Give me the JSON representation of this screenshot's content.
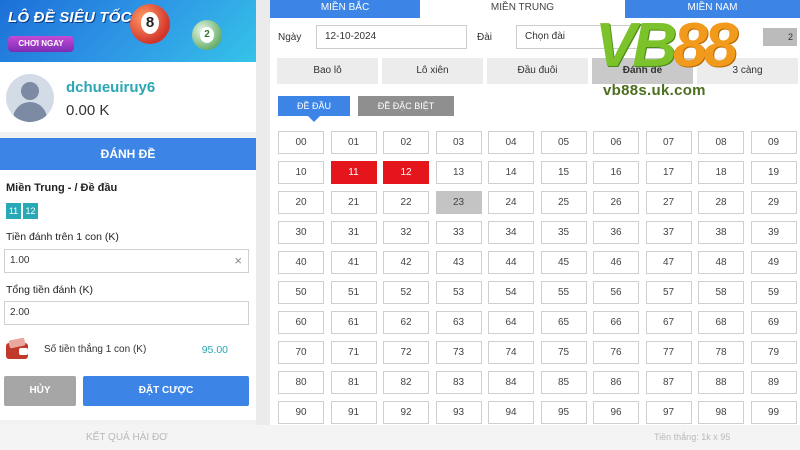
{
  "banner": {
    "title": "LÔ ĐỀ SIÊU TỐC",
    "button": "CHƠI NGAY",
    "ball_big": "8",
    "ball_small": "2"
  },
  "user": {
    "name": "dchueuiruy6",
    "balance": "0.00 K"
  },
  "bet_panel": {
    "header": "ĐÁNH ĐỀ",
    "title": "Miền Trung - / Đề đầu",
    "chips": [
      "11",
      "12"
    ],
    "per_unit_label": "Tiền đánh trên 1 con (K)",
    "per_unit_value": "1.00",
    "total_label": "Tổng tiền đánh (K)",
    "total_value": "2.00",
    "win_label": "Số tiền thắng 1 con (K)",
    "win_value": "95.00",
    "cancel": "HỦY",
    "submit": "ĐẶT CƯỢC"
  },
  "regions": [
    "MIỀN BẮC",
    "MIỀN TRUNG",
    "MIỀN NAM"
  ],
  "active_region": 1,
  "filters": {
    "date_label": "Ngày",
    "date": "12-10-2024",
    "station_label": "Đài",
    "station": "Chọn đài",
    "extra_number": "2"
  },
  "game_tabs": [
    "Bao lô",
    "Lô xiên",
    "Đầu đuôi",
    "Đánh đề",
    "3 càng"
  ],
  "active_game_tab": 3,
  "sub_tabs": [
    "ĐỀ ĐẦU",
    "ĐỀ ĐẶC BIỆT"
  ],
  "numbers": [
    "00",
    "01",
    "02",
    "03",
    "04",
    "05",
    "06",
    "07",
    "08",
    "09",
    "10",
    "11",
    "12",
    "13",
    "14",
    "15",
    "16",
    "17",
    "18",
    "19",
    "20",
    "21",
    "22",
    "23",
    "24",
    "25",
    "26",
    "27",
    "28",
    "29",
    "30",
    "31",
    "32",
    "33",
    "34",
    "35",
    "36",
    "37",
    "38",
    "39",
    "40",
    "41",
    "42",
    "43",
    "44",
    "45",
    "46",
    "47",
    "48",
    "49",
    "50",
    "51",
    "52",
    "53",
    "54",
    "55",
    "56",
    "57",
    "58",
    "59",
    "60",
    "61",
    "62",
    "63",
    "64",
    "65",
    "66",
    "67",
    "68",
    "69",
    "70",
    "71",
    "72",
    "73",
    "74",
    "75",
    "76",
    "77",
    "78",
    "79",
    "80",
    "81",
    "82",
    "83",
    "84",
    "85",
    "86",
    "87",
    "88",
    "89",
    "90",
    "91",
    "92",
    "93",
    "94",
    "95",
    "96",
    "97",
    "98",
    "99"
  ],
  "selected_numbers": [
    "11",
    "12"
  ],
  "highlighted_numbers": [
    "23"
  ],
  "bottom": {
    "results": "KẾT QUẢ HÀI ĐƠ",
    "win_text": "Tiền thắng: 1k x 95"
  },
  "watermark": {
    "brand_letters": "VB",
    "brand_number": "88",
    "url": "vb88s.uk.com"
  },
  "colors": {
    "primary": "#3c85e7",
    "accent": "#2aa6b4",
    "selected": "#e4161c"
  }
}
